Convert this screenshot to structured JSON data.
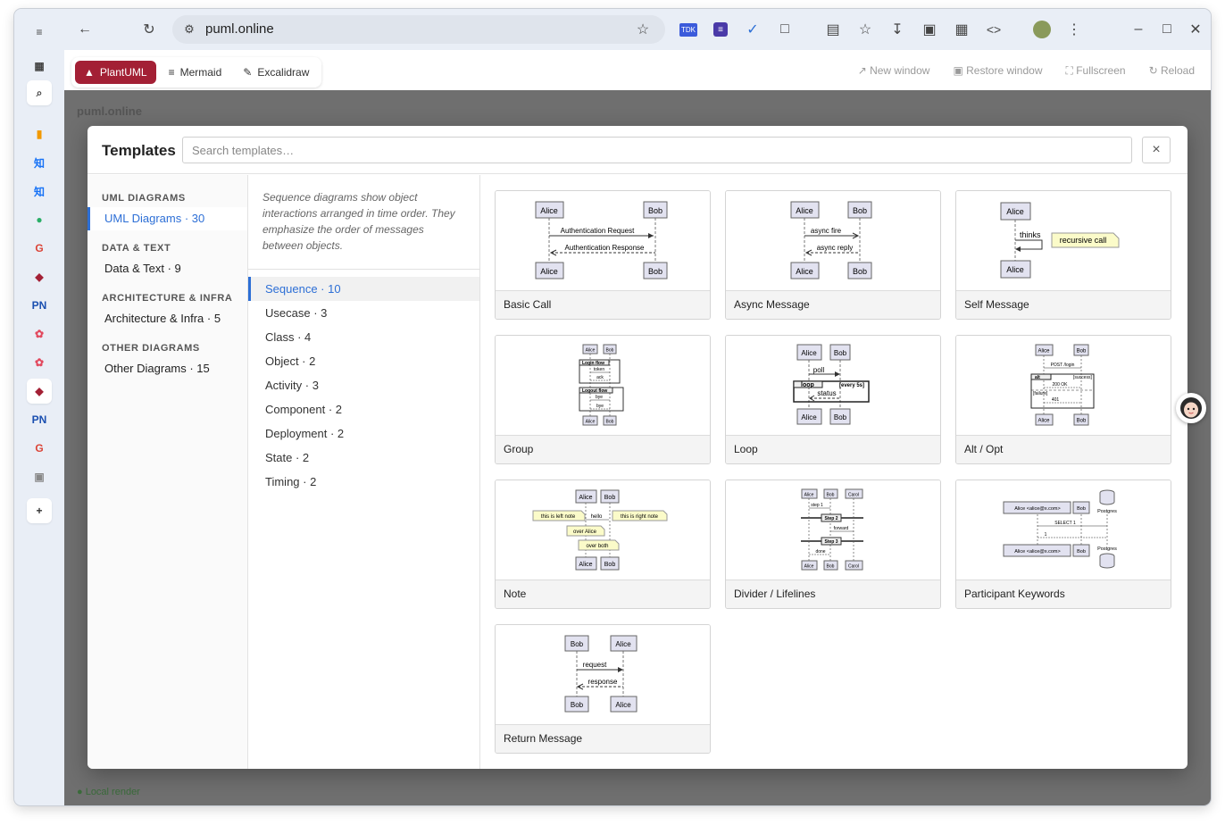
{
  "browser": {
    "url": "puml.online",
    "rail_icons": [
      "sidebar-toggle-icon",
      "apps-icon",
      "search-tab-icon",
      "analytics-icon",
      "zhihu-icon",
      "zhihu-icon",
      "wechat-icon",
      "google-icon",
      "plantuml-icon",
      "pn-icon",
      "flower-icon",
      "flower-icon",
      "plantuml-icon",
      "pn-icon",
      "google-icon",
      "image-icon",
      "add-icon"
    ],
    "toolbar_icons": [
      "tdk-extension-icon",
      "forms-extension-icon",
      "vscode-extension-icon",
      "puzzle-icon",
      "reading-list-icon",
      "bookmark-star-icon",
      "download-icon",
      "reader-icon",
      "qr-code-icon",
      "code-icon",
      "profile-avatar",
      "more-icon"
    ]
  },
  "modes": {
    "plantuml": "PlantUML",
    "mermaid": "Mermaid",
    "excalidraw": "Excalidraw"
  },
  "window_actions": {
    "new_window": "New window",
    "restore_window": "Restore window",
    "fullscreen": "Fullscreen",
    "reload": "Reload"
  },
  "background": {
    "site_title": "puml.online",
    "status": "● Local render"
  },
  "modal": {
    "title": "Templates",
    "search_placeholder": "Search templates…",
    "close": "×",
    "groups": [
      {
        "header": "UML DIAGRAMS",
        "item": "UML Diagrams · 30"
      },
      {
        "header": "DATA & TEXT",
        "item": "Data & Text · 9"
      },
      {
        "header": "ARCHITECTURE & INFRA",
        "item": "Architecture & Infra · 5"
      },
      {
        "header": "OTHER DIAGRAMS",
        "item": "Other Diagrams · 15"
      }
    ],
    "description": "Sequence diagrams show object interactions arranged in time order. They emphasize the order of messages between objects.",
    "subcategories": [
      "Sequence · 10",
      "Usecase · 3",
      "Class · 4",
      "Object · 2",
      "Activity · 3",
      "Component · 2",
      "Deployment · 2",
      "State · 2",
      "Timing · 2"
    ],
    "templates": [
      {
        "name": "Basic Call",
        "preview": {
          "p1": "Alice",
          "p2": "Bob",
          "m1": "Authentication Request",
          "m2": "Authentication Response"
        }
      },
      {
        "name": "Async Message",
        "preview": {
          "p1": "Alice",
          "p2": "Bob",
          "m1": "async fire",
          "m2": "async reply"
        }
      },
      {
        "name": "Self Message",
        "preview": {
          "p1": "Alice",
          "m1": "thinks",
          "note": "recursive call"
        }
      },
      {
        "name": "Group",
        "preview": {
          "p1": "Alice",
          "p2": "Bob",
          "g1": "Login flow",
          "g2": "Logout flow",
          "m1": "token",
          "m2": "ack",
          "m3": "bye",
          "m4": "bye"
        }
      },
      {
        "name": "Loop",
        "preview": {
          "p1": "Alice",
          "p2": "Bob",
          "m1": "poll",
          "m2": "status",
          "loop": "loop",
          "cond": "[every 5s]"
        }
      },
      {
        "name": "Alt / Opt",
        "preview": {
          "p1": "Alice",
          "p2": "Bob",
          "m1": "POST /login",
          "alt": "alt",
          "c1": "[success]",
          "m2": "200 OK",
          "c2": "[failure]",
          "m3": "401"
        }
      },
      {
        "name": "Note",
        "preview": {
          "p1": "Alice",
          "p2": "Bob",
          "m1": "hello",
          "n1": "this is left note",
          "n2": "this is right note",
          "n3": "over Alice",
          "n4": "over both"
        }
      },
      {
        "name": "Divider / Lifelines",
        "preview": {
          "p1": "Alice",
          "p2": "Bob",
          "p3": "Carol",
          "m1": "step 1",
          "d1": "Step 2",
          "m2": "forward",
          "d2": "Step 3",
          "m3": "done"
        }
      },
      {
        "name": "Participant Keywords",
        "preview": {
          "p1": "Alice <alice@x.com>",
          "p2": "Bob",
          "p3": "Postgres",
          "m1": "SELECT 1",
          "m2": "1"
        }
      },
      {
        "name": "Return Message",
        "preview": {
          "p1": "Bob",
          "p2": "Alice",
          "m1": "request",
          "m2": "response"
        }
      }
    ]
  }
}
